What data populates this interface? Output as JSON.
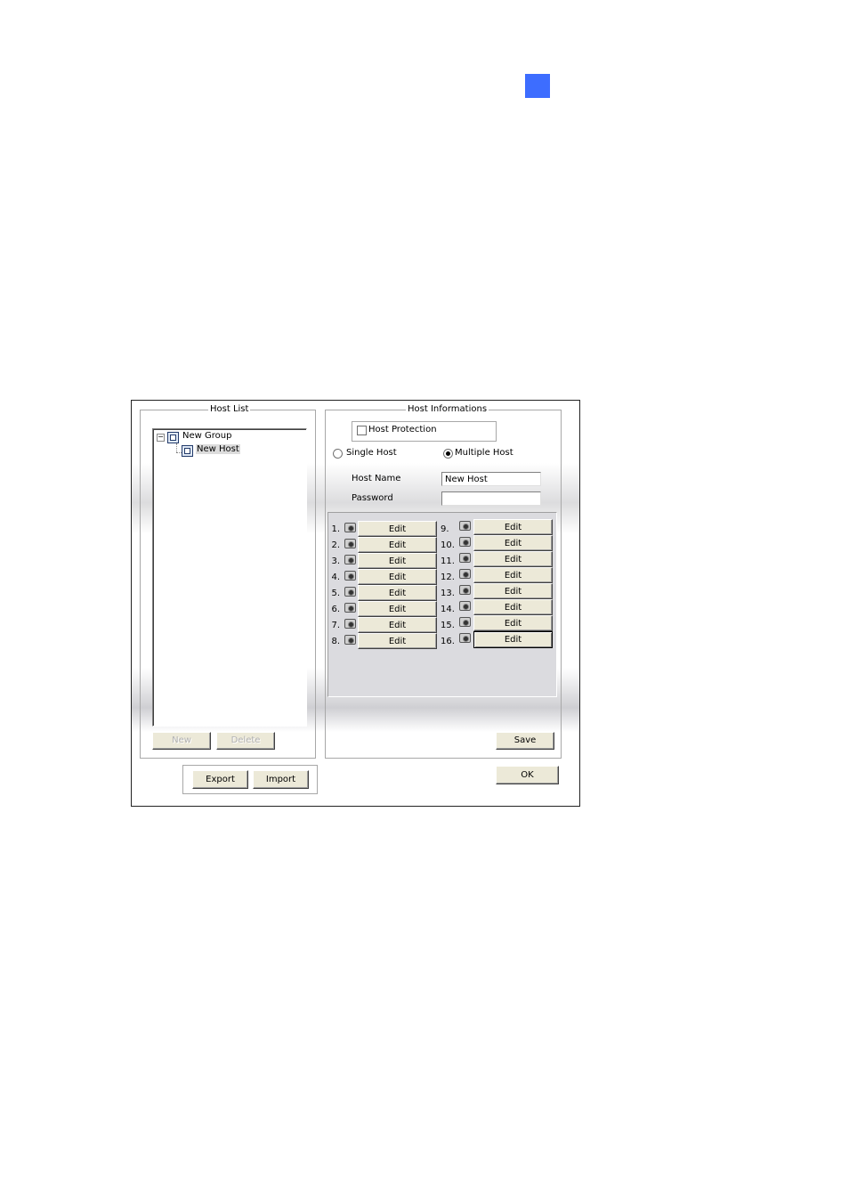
{
  "host_list": {
    "title": "Host List",
    "tree": {
      "group_label": "New Group",
      "expander": "−",
      "host_label": "New Host"
    },
    "new_label": "New",
    "delete_label": "Delete"
  },
  "export_label": "Export",
  "import_label": "Import",
  "host_info": {
    "title": "Host Informations",
    "host_protection_label": "Host Protection",
    "single_host_label": "Single Host",
    "multiple_host_label": "Multiple Host",
    "host_name_label": "Host Name",
    "host_name_value": "New Host",
    "password_label": "Password",
    "password_value": "",
    "camera_numbers": [
      "1.",
      "2.",
      "3.",
      "4.",
      "5.",
      "6.",
      "7.",
      "8.",
      "9.",
      "10.",
      "11.",
      "12.",
      "13.",
      "14.",
      "15.",
      "16."
    ],
    "edit_label": "Edit",
    "save_label": "Save"
  },
  "ok_label": "OK",
  "colors": {
    "accent_square": "#3d6dff",
    "button_face": "#ece9d8",
    "panel_gray": "#dbdbdf"
  },
  "icons": {
    "camera": "camera-icon",
    "group": "group-icon",
    "host": "host-icon"
  }
}
